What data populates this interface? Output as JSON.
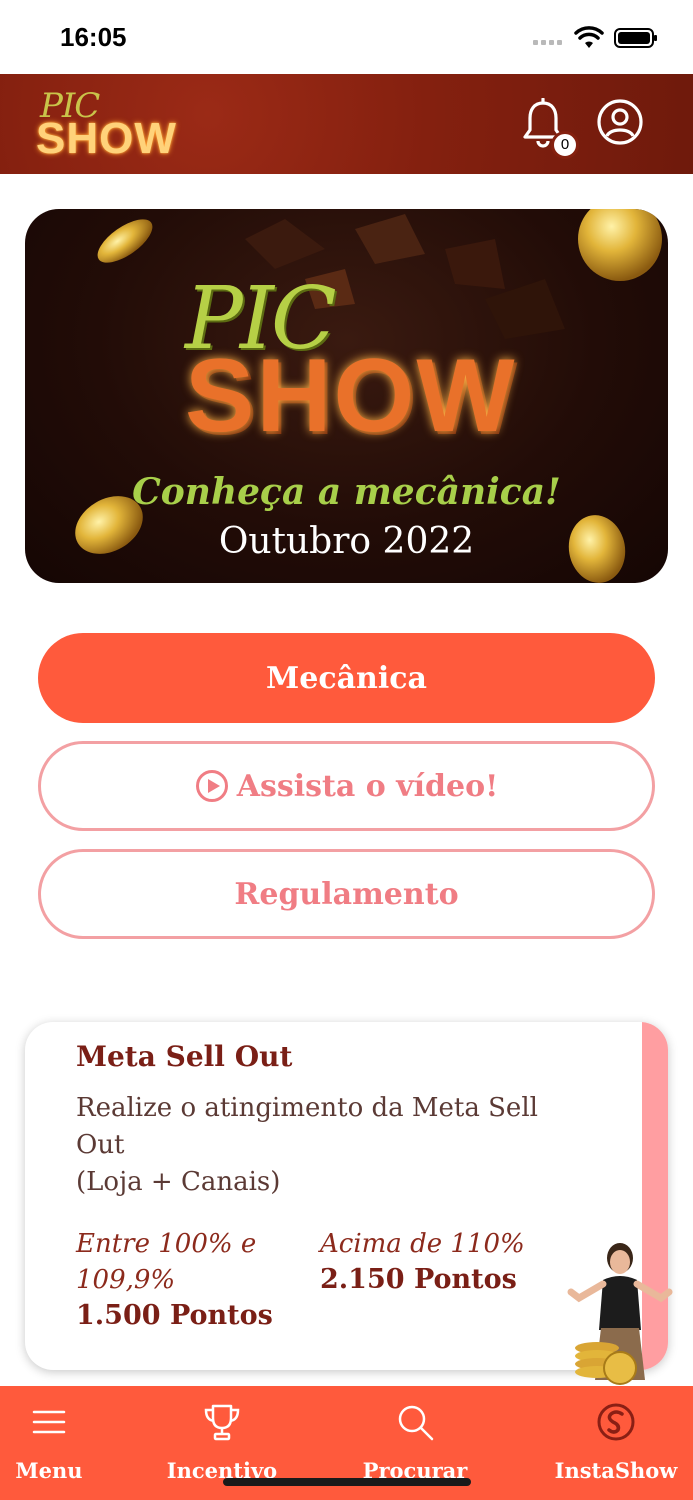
{
  "status_bar": {
    "time": "16:05"
  },
  "header": {
    "logo_top": "PIC",
    "logo_bottom": "SHOW",
    "notification_count": "0"
  },
  "banner": {
    "logo_top": "PIC",
    "logo_bottom": "SHOW",
    "tagline": "Conheça a mecânica!",
    "date": "Outubro 2022"
  },
  "buttons": {
    "mechanics": "Mecânica",
    "video": "Assista o vídeo!",
    "regulation": "Regulamento"
  },
  "card": {
    "title": "Meta Sell Out",
    "description_line1": "Realize o atingimento da Meta Sell Out",
    "description_line2": "(Loja + Canais)",
    "tiers": [
      {
        "range": "Entre 100% e 109,9%",
        "points": "1.500 Pontos"
      },
      {
        "range": "Acima de 110%",
        "points": "2.150 Pontos"
      }
    ]
  },
  "bottom_nav": {
    "items": [
      {
        "label": "Menu",
        "icon": "hamburger-icon"
      },
      {
        "label": "Incentivo",
        "icon": "trophy-icon"
      },
      {
        "label": "Procurar",
        "icon": "search-icon"
      },
      {
        "label": "InstaShow",
        "icon": "instashow-logo-icon"
      }
    ]
  },
  "colors": {
    "brand_dark": "#84200f",
    "primary": "#ff5a3c",
    "outline": "#f3a0a3",
    "card_accent": "#ff9ea1"
  }
}
